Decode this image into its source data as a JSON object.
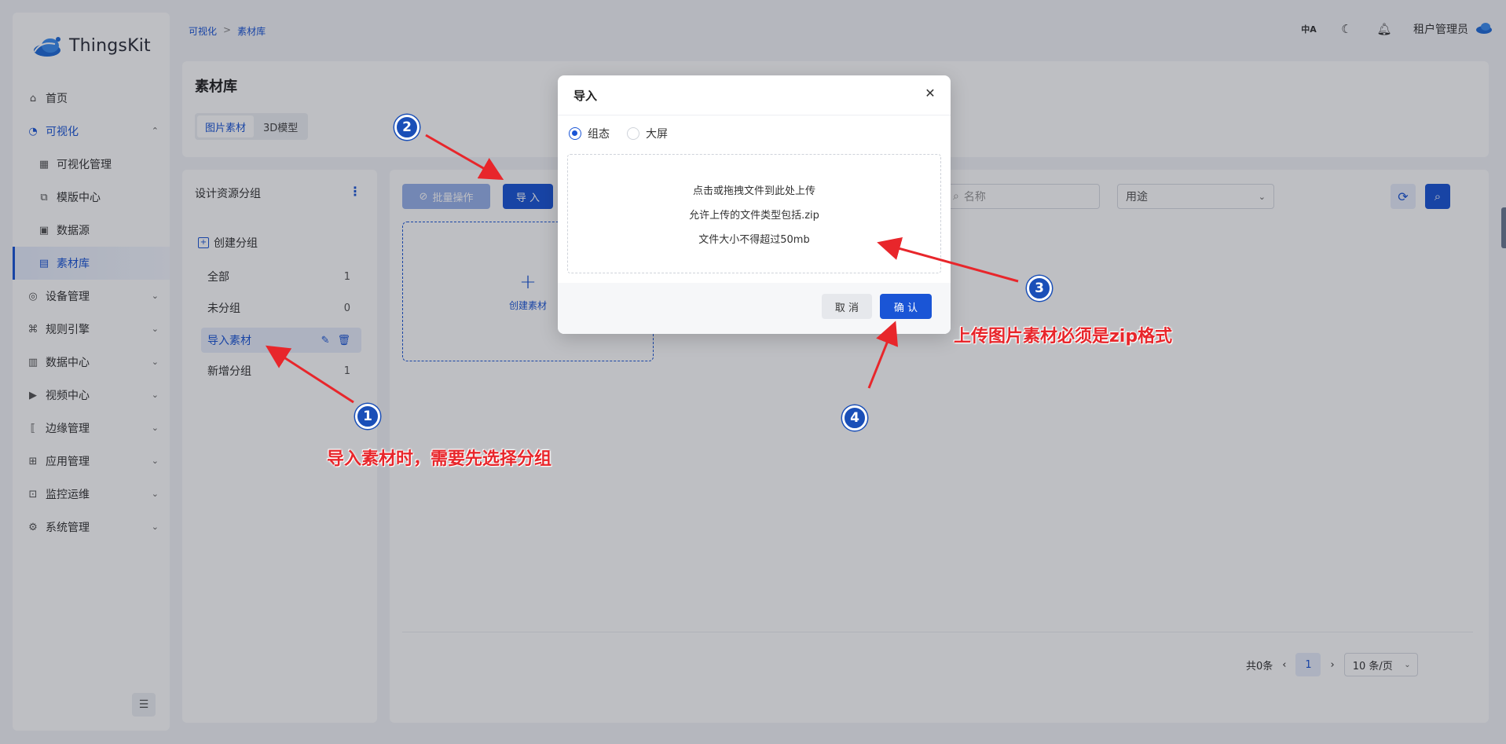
{
  "app": {
    "name": "ThingsKit"
  },
  "breadcrumb": {
    "items": [
      "可视化",
      "素材库"
    ],
    "separator": ">"
  },
  "header": {
    "lang_icon": "中A",
    "user": "租户管理员"
  },
  "sidebar": {
    "items": [
      {
        "label": "首页",
        "icon": "home-icon"
      },
      {
        "label": "可视化",
        "icon": "dashboard-icon",
        "open": true
      },
      {
        "label": "可视化管理",
        "icon": "layout-icon",
        "sub": true
      },
      {
        "label": "模版中心",
        "icon": "tree-icon",
        "sub": true
      },
      {
        "label": "数据源",
        "icon": "database-icon",
        "sub": true
      },
      {
        "label": "素材库",
        "icon": "material-icon",
        "sub": true,
        "active": true
      },
      {
        "label": "设备管理",
        "icon": "device-icon"
      },
      {
        "label": "规则引擎",
        "icon": "rule-icon"
      },
      {
        "label": "数据中心",
        "icon": "chart-icon"
      },
      {
        "label": "视频中心",
        "icon": "video-icon"
      },
      {
        "label": "边缘管理",
        "icon": "edge-icon"
      },
      {
        "label": "应用管理",
        "icon": "app-icon"
      },
      {
        "label": "监控运维",
        "icon": "monitor-icon"
      },
      {
        "label": "系统管理",
        "icon": "gear-icon"
      }
    ]
  },
  "title_card": {
    "title": "素材库",
    "tabs": [
      "图片素材",
      "3D模型"
    ],
    "active_tab": 0
  },
  "groups": {
    "title": "设计资源分组",
    "create_label": "创建分组",
    "items": [
      {
        "label": "全部",
        "count": "1"
      },
      {
        "label": "未分组",
        "count": "0"
      },
      {
        "label": "导入素材",
        "count": "",
        "selected": true
      },
      {
        "label": "新增分组",
        "count": "1"
      }
    ]
  },
  "toolbar": {
    "batch_label": "批量操作",
    "import_label": "导 入",
    "create_card_label": "创建素材",
    "search_placeholder": "名称",
    "use_select": "用途"
  },
  "pagination": {
    "total": "共0条",
    "page": "1",
    "page_size": "10 条/页"
  },
  "modal": {
    "title": "导入",
    "radio_options": [
      "组态",
      "大屏"
    ],
    "selected": 0,
    "drop_lines": [
      "点击或拖拽文件到此处上传",
      "允许上传的文件类型包括.zip",
      "文件大小不得超过50mb"
    ],
    "cancel_label": "取 消",
    "ok_label": "确 认"
  },
  "annotations": {
    "badges": [
      "1",
      "2",
      "3",
      "4"
    ],
    "note1": "导入素材时，需要先选择分组",
    "note2": "上传图片素材必须是zip格式"
  },
  "colors": {
    "primary": "#1a55d6",
    "annotation_red": "#e8262b",
    "badge_blue": "#1a4fb8"
  }
}
